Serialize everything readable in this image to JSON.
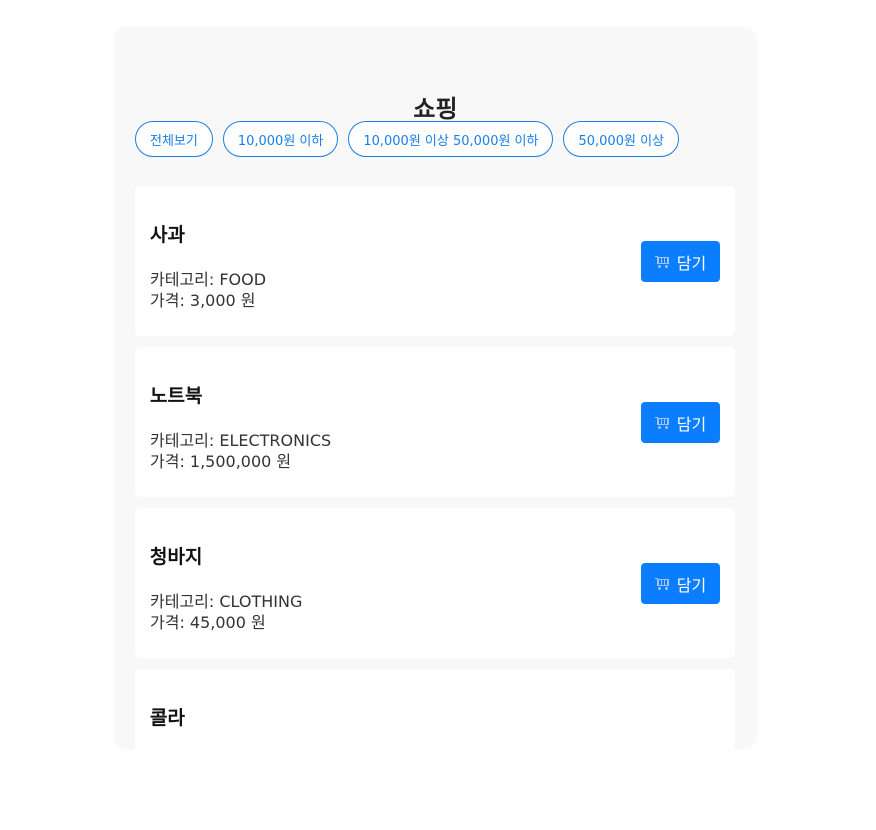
{
  "page": {
    "title": "쇼핑"
  },
  "filters": [
    {
      "label": "전체보기"
    },
    {
      "label": "10,000원 이하"
    },
    {
      "label": "10,000원 이상 50,000원 이하"
    },
    {
      "label": "50,000원 이상"
    }
  ],
  "products": [
    {
      "name": "사과",
      "category": "카테고리: FOOD",
      "price": "가격: 3,000 원",
      "button_label": "담기",
      "button_icon": "cart-icon"
    },
    {
      "name": "노트북",
      "category": "카테고리: ELECTRONICS",
      "price": "가격: 1,500,000 원",
      "button_label": "담기",
      "button_icon": "cart-icon"
    },
    {
      "name": "청바지",
      "category": "카테고리: CLOTHING",
      "price": "가격: 45,000 원",
      "button_label": "담기",
      "button_icon": "cart-icon"
    },
    {
      "name": "콜라",
      "category": "",
      "price": "",
      "button_label": "",
      "button_icon": "cart-icon"
    }
  ],
  "colors": {
    "accent": "#0b7dff",
    "filter_border": "#1a7ee6",
    "panel_bg": "#f8f8f8"
  }
}
